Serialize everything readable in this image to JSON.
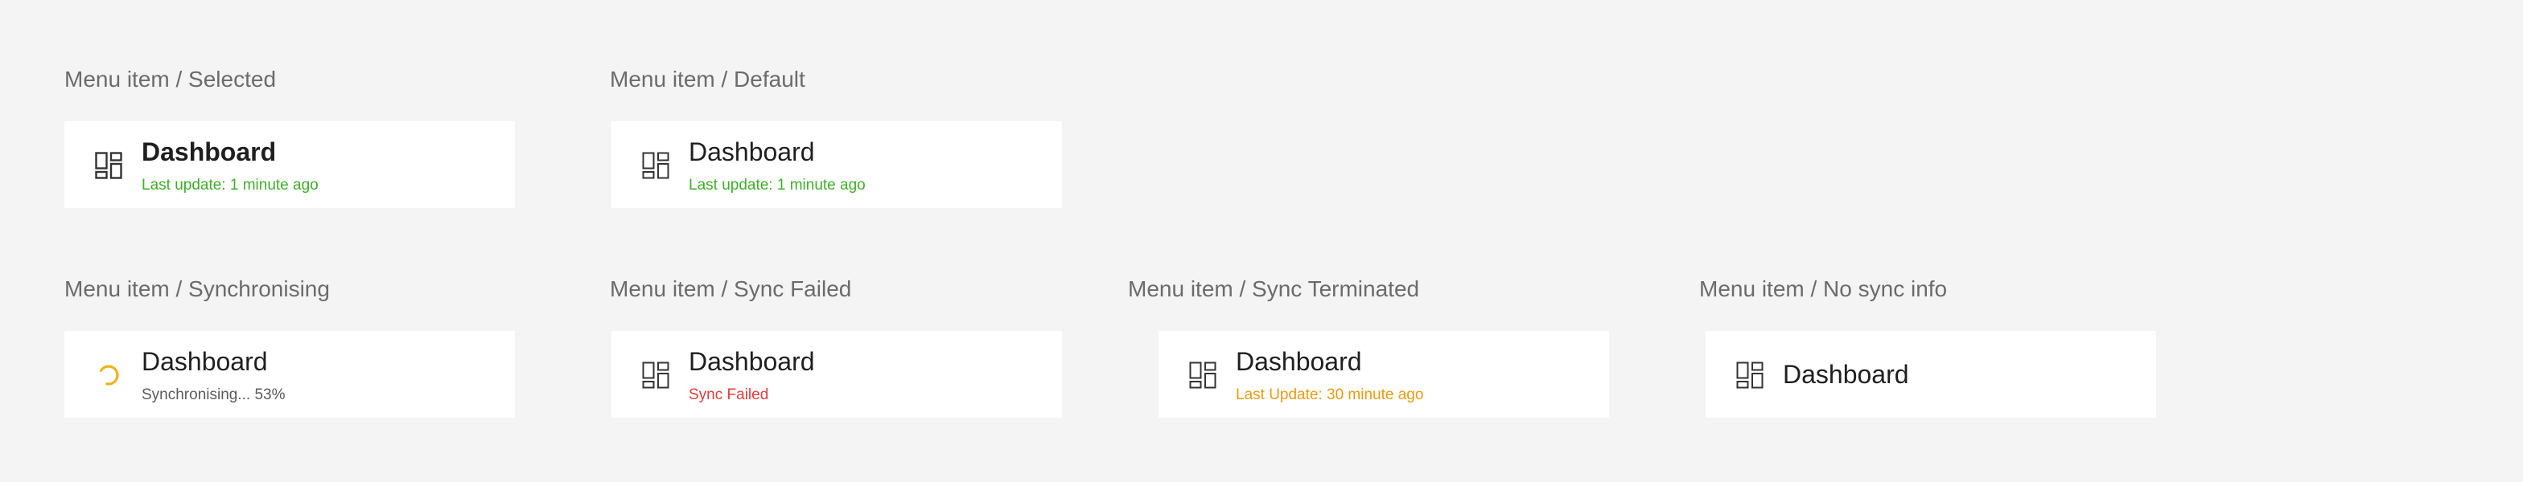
{
  "colors": {
    "success": "#3fae2a",
    "error": "#e23b3b",
    "warning": "#e89b10",
    "neutral": "#5a5a5a",
    "spinner": "#f0b21a"
  },
  "variants": [
    {
      "label": "Menu item / Selected",
      "title": "Dashboard",
      "status": "Last update: 1 minute ago",
      "icon": "dashboard-icon"
    },
    {
      "label": "Menu item / Default",
      "title": "Dashboard",
      "status": "Last update: 1 minute ago",
      "icon": "dashboard-icon"
    },
    {
      "label": "Menu item / Synchronising",
      "title": "Dashboard",
      "status": "Synchronising... 53%",
      "icon": "spinner-icon"
    },
    {
      "label": "Menu item / Sync Failed",
      "title": "Dashboard",
      "status": "Sync Failed",
      "icon": "dashboard-icon"
    },
    {
      "label": "Menu item / Sync Terminated",
      "title": "Dashboard",
      "status": "Last Update: 30 minute ago",
      "icon": "dashboard-icon"
    },
    {
      "label": "Menu item / No sync info",
      "title": "Dashboard",
      "icon": "dashboard-icon"
    }
  ]
}
